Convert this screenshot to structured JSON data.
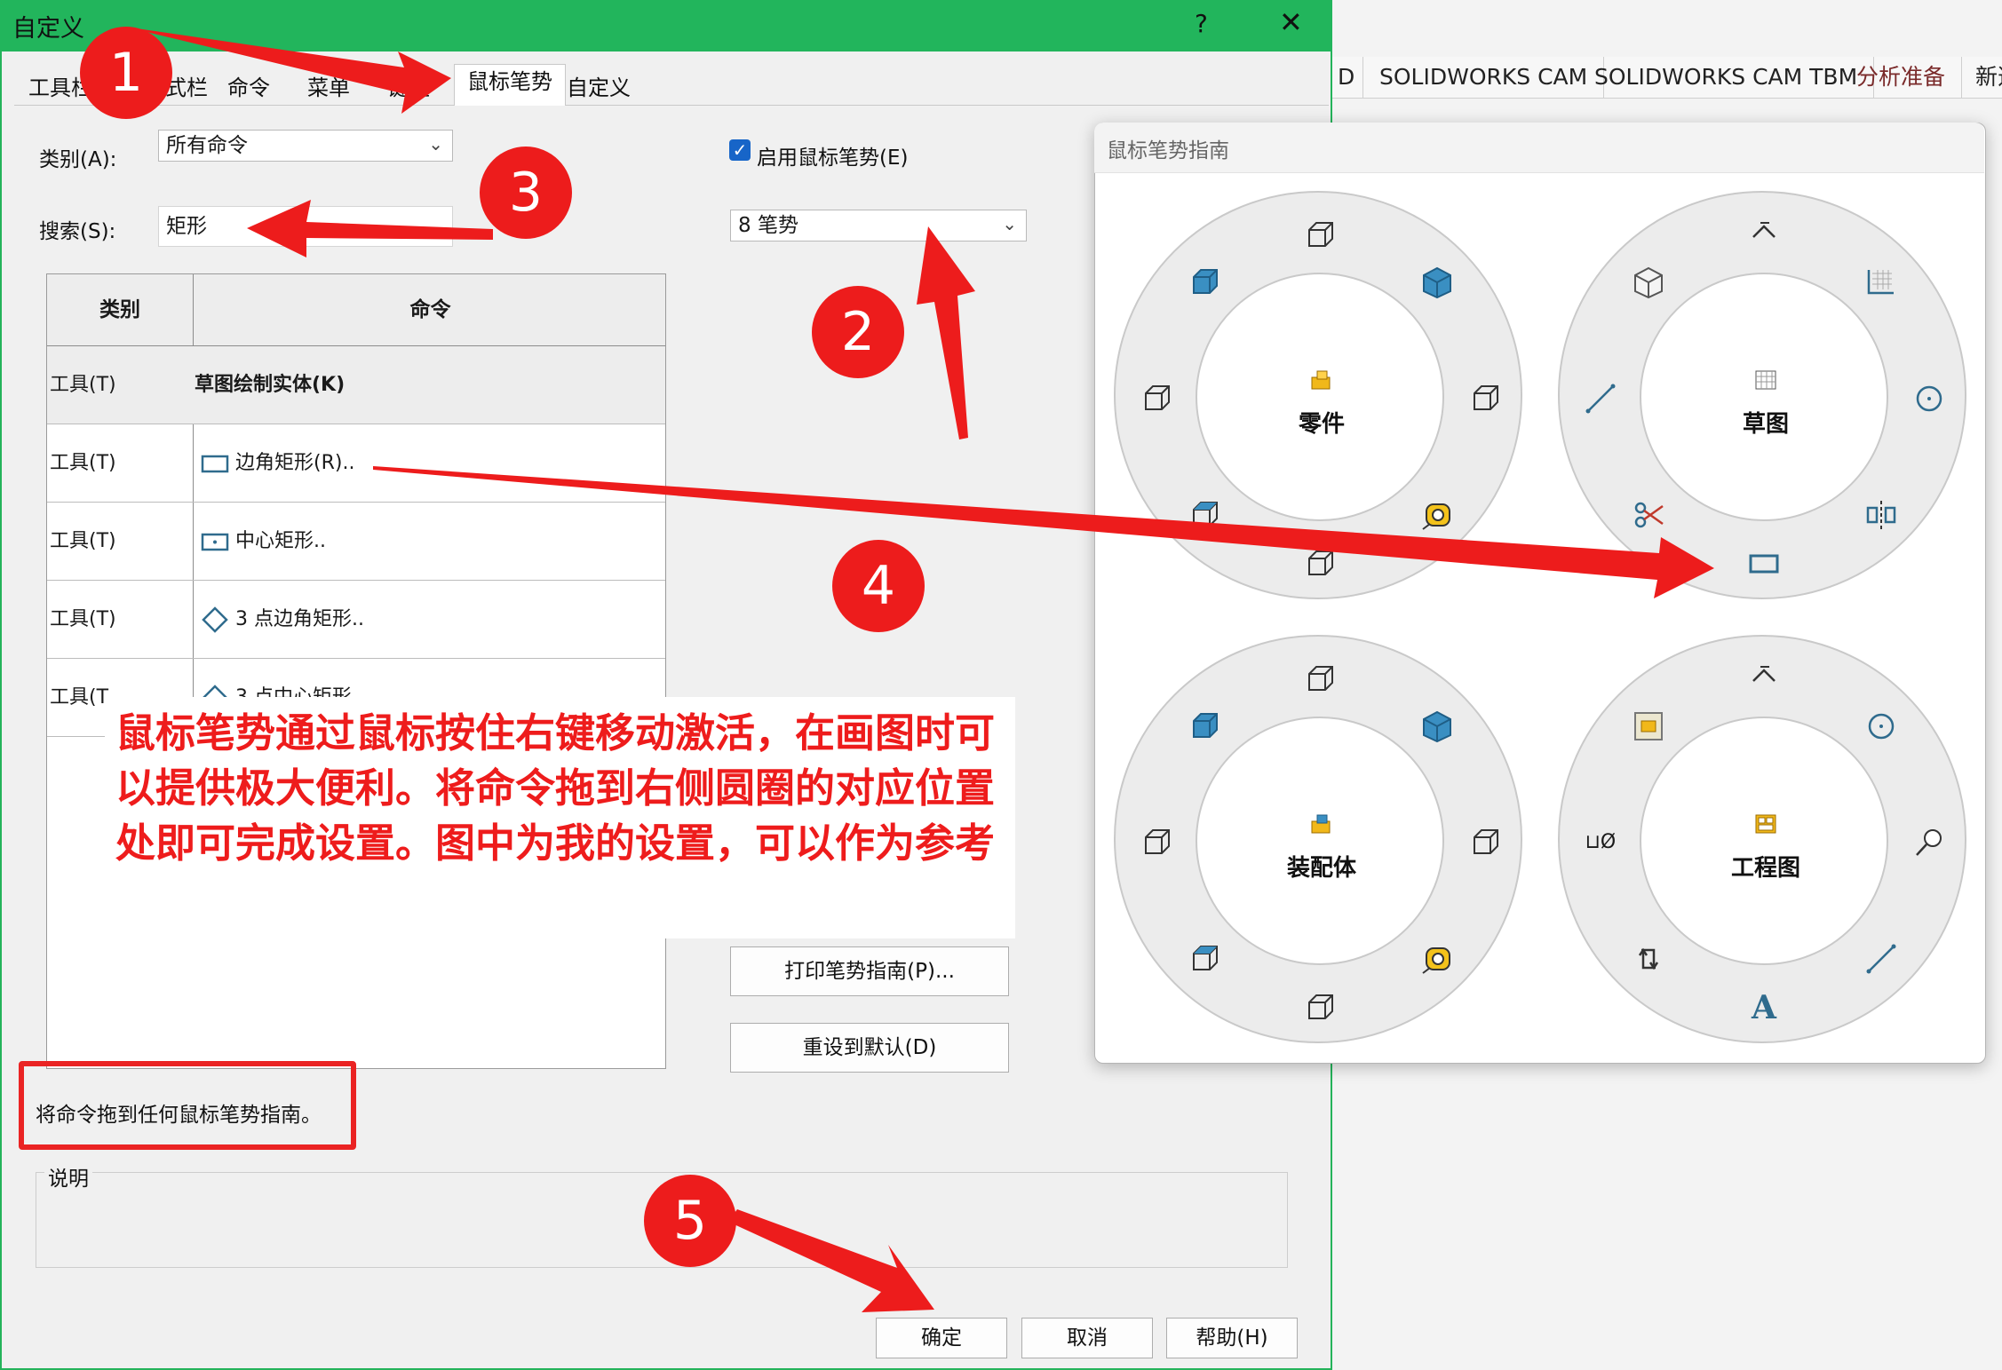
{
  "dialog": {
    "title": "自定义",
    "help_glyph": "?",
    "close_glyph": "✕",
    "tabs": [
      "工具栏",
      "式栏",
      "命令",
      "菜单",
      "键盘",
      "鼠标笔势",
      "自定义"
    ],
    "active_tab": "鼠标笔势",
    "category_label": "类别(A):",
    "category_value": "所有命令",
    "search_label": "搜索(S):",
    "search_value": "矩形",
    "enable_gestures_label": "启用鼠标笔势(E)",
    "enable_gestures_checked": true,
    "gesture_count_value": "8 笔势",
    "table": {
      "headers": [
        "类别",
        "命令"
      ],
      "rows": [
        {
          "category": "工具(T)",
          "command": "草图绘制实体(K)",
          "bold": true
        },
        {
          "category": "工具(T)",
          "command": "边角矩形(R).."
        },
        {
          "category": "工具(T)",
          "command": "中心矩形.."
        },
        {
          "category": "工具(T)",
          "command": "3 点边角矩形.."
        },
        {
          "category": "工具(T",
          "command": "3 点中心矩形.."
        }
      ]
    },
    "print_button": "打印笔势指南(P)...",
    "reset_button": "重设到默认(D)",
    "hint_text": "将命令拖到任何鼠标笔势指南。",
    "description_label": "说明",
    "ok_button": "确定",
    "cancel_button": "取消",
    "help_button": "帮助(H)"
  },
  "background_ribbon": {
    "tabs": [
      "D",
      "SOLIDWORKS CAM",
      "SOLIDWORKS CAM TBM",
      "分析准备",
      "新选"
    ]
  },
  "gesture_guide": {
    "title": "鼠标笔势指南",
    "rings": [
      {
        "label": "零件",
        "icons": [
          "cube-wire-top-icon",
          "cube-blue-tr-icon",
          "cube-wire-right-icon",
          "measure-icon",
          "cube-wire-bottom-icon",
          "cube-wire-bl-icon",
          "cube-wire-left-icon",
          "cube-blue-tl-icon"
        ]
      },
      {
        "label": "草图",
        "icons": [
          "smart-dimension-icon",
          "grid-icon",
          "circle-icon",
          "mirror-icon",
          "rectangle-icon",
          "trim-icon",
          "line-icon",
          "cube-white-icon"
        ]
      },
      {
        "label": "装配体",
        "icons": [
          "cube-wire-top-icon",
          "cube-blue-tr-icon",
          "cube-wire-right-icon",
          "measure-icon",
          "cube-wire-bottom-icon",
          "cube-wire-bl-icon",
          "cube-wire-left-icon",
          "cube-blue-tl-icon"
        ]
      },
      {
        "label": "工程图",
        "icons": [
          "smart-dimension-icon",
          "circle-icon",
          "balloon-icon",
          "line-icon",
          "note-icon",
          "rotate-icon",
          "hole-callout-icon",
          "model-view-icon"
        ]
      }
    ],
    "hole_callout_text": "⊔Ø",
    "note_text": "A"
  },
  "annotations": {
    "numbers": [
      "1",
      "2",
      "3",
      "4",
      "5"
    ],
    "note": "鼠标笔势通过鼠标按住右键移动激活，在画图时可以提供极大便利。将命令拖到右侧圆圈的对应位置处即可完成设置。图中为我的设置，可以作为参考",
    "accent_color": "#ed1c1c"
  },
  "colors": {
    "title_bar": "#22b55c",
    "checkbox": "#1765c8"
  }
}
